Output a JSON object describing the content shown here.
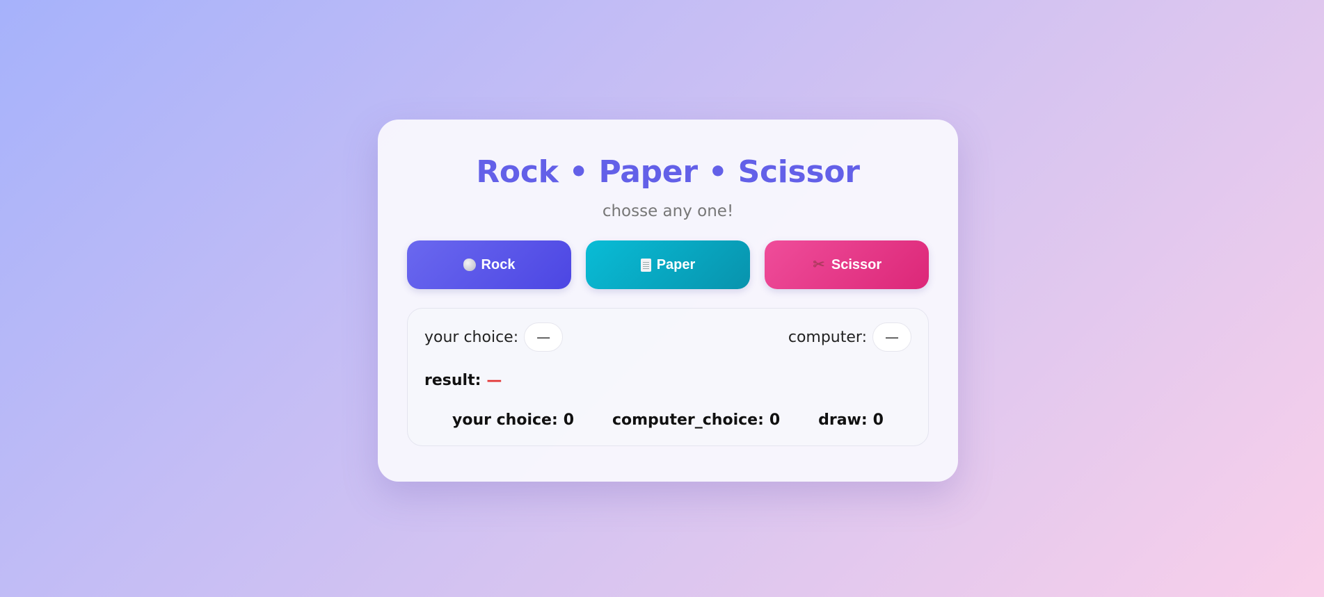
{
  "header": {
    "title": "Rock • Paper • Scissor",
    "subtitle": "chosse any one!"
  },
  "choices": [
    {
      "label": "Rock",
      "icon": "rock-icon",
      "color": "#5a57ea"
    },
    {
      "label": "Paper",
      "icon": "paper-icon",
      "color": "#08a8c2"
    },
    {
      "label": "Scissor",
      "icon": "scissor-icon",
      "color": "#e63a89"
    }
  ],
  "panel": {
    "your_choice_label": "your choice:",
    "your_choice_value": "—",
    "computer_label": "computer:",
    "computer_value": "—",
    "result_label": "result:",
    "result_value": "—"
  },
  "score": {
    "your_label": "your choice:",
    "your_value": "0",
    "computer_label": "computer_choice:",
    "computer_value": "0",
    "draw_label": "draw:",
    "draw_value": "0"
  },
  "colors": {
    "accent": "#6360e8",
    "result": "#e23838"
  }
}
